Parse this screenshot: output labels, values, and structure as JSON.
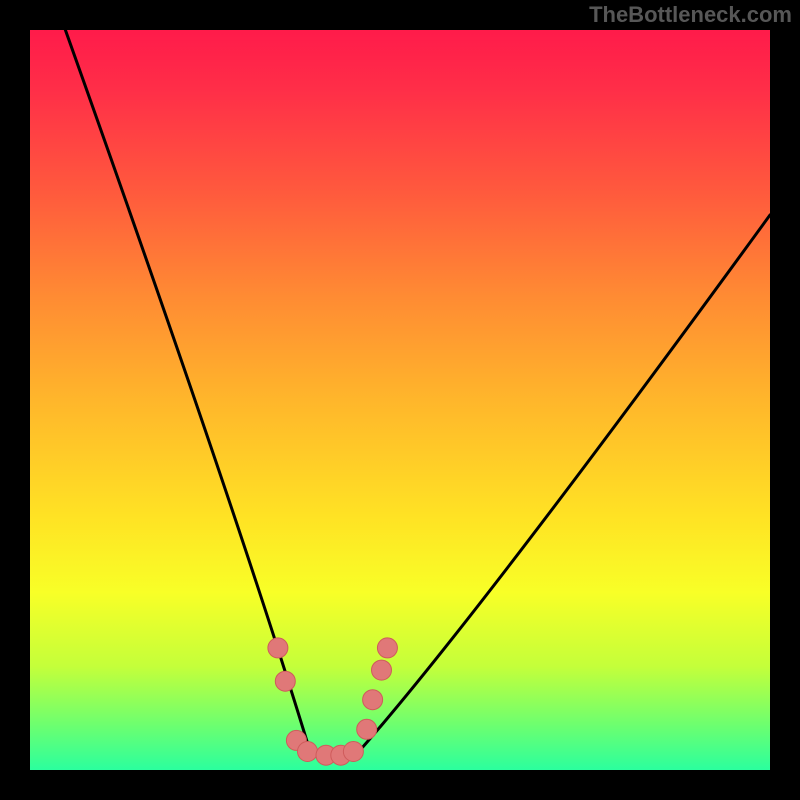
{
  "watermark": "TheBottleneck.com",
  "colors": {
    "bg": "#000000",
    "gradient_top": "#ff1b4a",
    "gradient_bottom": "#2bff9e",
    "curve": "#000000",
    "marker_fill": "#e07878",
    "marker_stroke": "#cf5b5b"
  },
  "chart_data": {
    "type": "line",
    "title": "",
    "xlabel": "",
    "ylabel": "",
    "x": [
      0.0,
      0.05,
      0.1,
      0.15,
      0.2,
      0.25,
      0.3,
      0.35,
      0.38,
      0.4,
      0.45,
      0.5,
      0.6,
      0.7,
      0.8,
      0.9,
      1.0
    ],
    "series": [
      {
        "name": "left",
        "values": [
          1.05,
          0.92,
          0.8,
          0.68,
          0.56,
          0.44,
          0.32,
          0.2,
          0.06,
          null,
          null,
          null,
          null,
          null,
          null,
          null,
          null
        ]
      },
      {
        "name": "valley",
        "values": [
          null,
          null,
          null,
          null,
          null,
          null,
          null,
          null,
          0.02,
          0.02,
          0.03,
          null,
          null,
          null,
          null,
          null,
          null
        ]
      },
      {
        "name": "right",
        "values": [
          null,
          null,
          null,
          null,
          null,
          null,
          null,
          null,
          null,
          null,
          0.05,
          0.14,
          0.3,
          0.44,
          0.56,
          0.66,
          0.75
        ]
      }
    ],
    "markers": [
      {
        "x": 0.335,
        "y": 0.165
      },
      {
        "x": 0.345,
        "y": 0.12
      },
      {
        "x": 0.36,
        "y": 0.04
      },
      {
        "x": 0.375,
        "y": 0.025
      },
      {
        "x": 0.4,
        "y": 0.02
      },
      {
        "x": 0.42,
        "y": 0.02
      },
      {
        "x": 0.437,
        "y": 0.025
      },
      {
        "x": 0.455,
        "y": 0.055
      },
      {
        "x": 0.463,
        "y": 0.095
      },
      {
        "x": 0.475,
        "y": 0.135
      },
      {
        "x": 0.483,
        "y": 0.165
      }
    ],
    "xlim": [
      0,
      1
    ],
    "ylim": [
      0,
      1
    ],
    "grid": false,
    "legend": false
  }
}
